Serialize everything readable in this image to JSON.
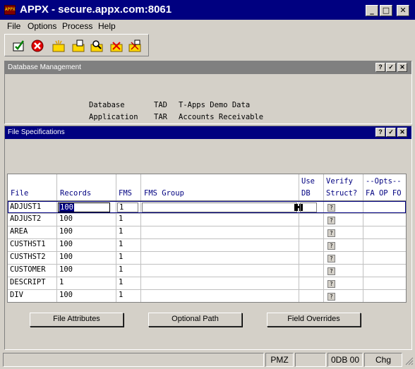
{
  "window": {
    "icon_text": "APPX",
    "title": "APPX - secure.appx.com:8061",
    "minimize": "_",
    "maximize": "□",
    "close": "✕"
  },
  "menu": [
    {
      "label": "File"
    },
    {
      "label": "Options"
    },
    {
      "label": "Process"
    },
    {
      "label": "Help"
    }
  ],
  "toolbar": {
    "icons": [
      "check-icon",
      "cancel-icon",
      "new-icon",
      "open-icon",
      "find-icon",
      "delete-icon"
    ]
  },
  "db_panel": {
    "title": "Database Management",
    "database_label": "Database",
    "database_code": "TAD",
    "database_name": "T-Apps Demo Data",
    "application_label": "Application",
    "application_code": "TAR",
    "application_name": "Accounts Receivable"
  },
  "file_spec": {
    "title": "File Specifications",
    "headers": {
      "file": "File",
      "records": "Records",
      "fms": "FMS",
      "fms_group": "FMS Group",
      "use_1": "Use",
      "use_2": "DB",
      "verify_1": "Verify",
      "verify_2": "Struct?",
      "opts_1": "--Opts--",
      "opts_2": "FA OP FO"
    },
    "rows": [
      {
        "file": "ADJUST1",
        "records": "100",
        "fms": "1",
        "verify": "?"
      },
      {
        "file": "ADJUST2",
        "records": "100",
        "fms": "1",
        "verify": "?"
      },
      {
        "file": "AREA",
        "records": "100",
        "fms": "1",
        "verify": "?"
      },
      {
        "file": "CUSTHST1",
        "records": "100",
        "fms": "1",
        "verify": "?"
      },
      {
        "file": "CUSTHST2",
        "records": "100",
        "fms": "1",
        "verify": "?"
      },
      {
        "file": "CUSTOMER",
        "records": "100",
        "fms": "1",
        "verify": "?"
      },
      {
        "file": "DESCRIPT",
        "records": "1",
        "fms": "1",
        "verify": "?"
      },
      {
        "file": "DIV",
        "records": "100",
        "fms": "1",
        "verify": "?"
      }
    ],
    "buttons": {
      "file_attributes": "File Attributes",
      "optional_path": "Optional Path",
      "field_overrides": "Field Overrides"
    }
  },
  "status": {
    "seg1": "PMZ",
    "seg2": "0DB 00",
    "seg3": "Chg"
  }
}
